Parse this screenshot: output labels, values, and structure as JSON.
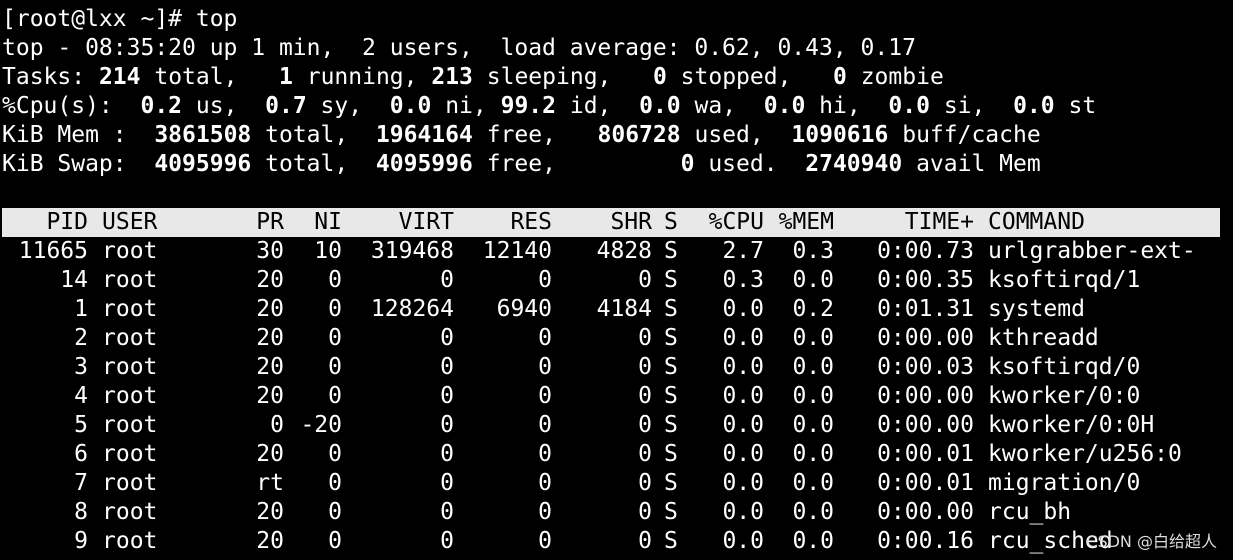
{
  "prompt": "[root@lxx ~]# top",
  "summary": {
    "line1": "top - 08:35:20 up 1 min,  2 users,  load average: 0.62, 0.43, 0.17",
    "tasks": {
      "label": "Tasks:",
      "total": "214",
      "total_label": "total,",
      "running": "1",
      "running_label": "running,",
      "sleeping": "213",
      "sleeping_label": "sleeping,",
      "stopped": "0",
      "stopped_label": "stopped,",
      "zombie": "0",
      "zombie_label": "zombie"
    },
    "cpu": {
      "label": "%Cpu(s):",
      "us": "0.2",
      "us_label": "us,",
      "sy": "0.7",
      "sy_label": "sy,",
      "ni": "0.0",
      "ni_label": "ni,",
      "id": "99.2",
      "id_label": "id,",
      "wa": "0.0",
      "wa_label": "wa,",
      "hi": "0.0",
      "hi_label": "hi,",
      "si": "0.0",
      "si_label": "si,",
      "st": "0.0",
      "st_label": "st"
    },
    "mem": {
      "label": "KiB Mem :",
      "total": "3861508",
      "total_label": "total,",
      "free": "1964164",
      "free_label": "free,",
      "used": "806728",
      "used_label": "used,",
      "buff": "1090616",
      "buff_label": "buff/cache"
    },
    "swap": {
      "label": "KiB Swap:",
      "total": "4095996",
      "total_label": "total,",
      "free": "4095996",
      "free_label": "free,",
      "used": "0",
      "used_label": "used.",
      "avail": "2740940",
      "avail_label": "avail Mem"
    }
  },
  "columns": {
    "pid": "PID",
    "user": "USER",
    "pr": "PR",
    "ni": "NI",
    "virt": "VIRT",
    "res": "RES",
    "shr": "SHR",
    "s": "S",
    "cpu": "%CPU",
    "mem": "%MEM",
    "time": "TIME+",
    "command": "COMMAND"
  },
  "processes": [
    {
      "pid": "11665",
      "user": "root",
      "pr": "30",
      "ni": "10",
      "virt": "319468",
      "res": "12140",
      "shr": "4828",
      "s": "S",
      "cpu": "2.7",
      "mem": "0.3",
      "time": "0:00.73",
      "command": "urlgrabber-ext-"
    },
    {
      "pid": "14",
      "user": "root",
      "pr": "20",
      "ni": "0",
      "virt": "0",
      "res": "0",
      "shr": "0",
      "s": "S",
      "cpu": "0.3",
      "mem": "0.0",
      "time": "0:00.35",
      "command": "ksoftirqd/1"
    },
    {
      "pid": "1",
      "user": "root",
      "pr": "20",
      "ni": "0",
      "virt": "128264",
      "res": "6940",
      "shr": "4184",
      "s": "S",
      "cpu": "0.0",
      "mem": "0.2",
      "time": "0:01.31",
      "command": "systemd"
    },
    {
      "pid": "2",
      "user": "root",
      "pr": "20",
      "ni": "0",
      "virt": "0",
      "res": "0",
      "shr": "0",
      "s": "S",
      "cpu": "0.0",
      "mem": "0.0",
      "time": "0:00.00",
      "command": "kthreadd"
    },
    {
      "pid": "3",
      "user": "root",
      "pr": "20",
      "ni": "0",
      "virt": "0",
      "res": "0",
      "shr": "0",
      "s": "S",
      "cpu": "0.0",
      "mem": "0.0",
      "time": "0:00.03",
      "command": "ksoftirqd/0"
    },
    {
      "pid": "4",
      "user": "root",
      "pr": "20",
      "ni": "0",
      "virt": "0",
      "res": "0",
      "shr": "0",
      "s": "S",
      "cpu": "0.0",
      "mem": "0.0",
      "time": "0:00.00",
      "command": "kworker/0:0"
    },
    {
      "pid": "5",
      "user": "root",
      "pr": "0",
      "ni": "-20",
      "virt": "0",
      "res": "0",
      "shr": "0",
      "s": "S",
      "cpu": "0.0",
      "mem": "0.0",
      "time": "0:00.00",
      "command": "kworker/0:0H"
    },
    {
      "pid": "6",
      "user": "root",
      "pr": "20",
      "ni": "0",
      "virt": "0",
      "res": "0",
      "shr": "0",
      "s": "S",
      "cpu": "0.0",
      "mem": "0.0",
      "time": "0:00.01",
      "command": "kworker/u256:0"
    },
    {
      "pid": "7",
      "user": "root",
      "pr": "rt",
      "ni": "0",
      "virt": "0",
      "res": "0",
      "shr": "0",
      "s": "S",
      "cpu": "0.0",
      "mem": "0.0",
      "time": "0:00.01",
      "command": "migration/0"
    },
    {
      "pid": "8",
      "user": "root",
      "pr": "20",
      "ni": "0",
      "virt": "0",
      "res": "0",
      "shr": "0",
      "s": "S",
      "cpu": "0.0",
      "mem": "0.0",
      "time": "0:00.00",
      "command": "rcu_bh"
    },
    {
      "pid": "9",
      "user": "root",
      "pr": "20",
      "ni": "0",
      "virt": "0",
      "res": "0",
      "shr": "0",
      "s": "S",
      "cpu": "0.0",
      "mem": "0.0",
      "time": "0:00.16",
      "command": "rcu_sched"
    }
  ],
  "watermark": "CSDN @白给超人"
}
